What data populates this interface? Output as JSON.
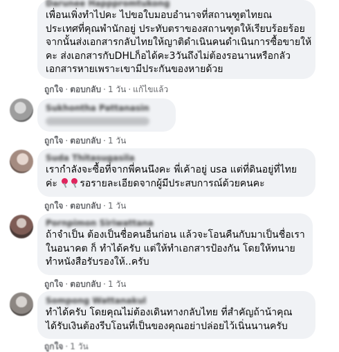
{
  "actions": {
    "like": "ถูกใจ",
    "reply": "ตอบกลับ",
    "edited": "แก้ไขแล้ว",
    "time": "1 วัน",
    "separator": "·"
  },
  "comments": [
    {
      "author": "Darunee Happpromtukong",
      "lines": [
        "เพื่อนเพิ่งทำไปคะ  ไปขอใบมอบอำนาจที่สถานฑูตไทยณ",
        "ประเทศที่คุณพำนักอยู่ ประทับตราของสถานฑูตให้เรียบร้อยร้อย",
        "จากนั้นส่งเอกสารกลับไทยให้ญาติดำเนินคนดำเนินการซื้อขายให้",
        "คะ ส่งเอกสารกับDHLก็อได้คะ3วันถึงไม่ต้องรอนานหรือกลัว",
        "เอกสารหายเพราะเขามีประกันของหายด้วย"
      ]
    },
    {
      "author": "Sukhontha Pattanasin",
      "lines": []
    },
    {
      "author": "Suda Thitasugasila",
      "lines": [
        "เรากำลังจะซื้อที่จากพี่คนนึงคะ  พี่เค้าอยู่ usa แต่ที่ดินอยู่ที่ไทย",
        "รอรายละเอียดจากผู้มีประสบการณ์ด้วยคนคะ"
      ],
      "line2_prefix": "ค่ะ"
    },
    {
      "author": "Pornpimon Siriwattana",
      "lines": [
        "ถ้าจำเป็น ต้องเป็นชื่อคนอื่นก่อน แล้วจะโอนคืนกับมาเป็นชื่อเรา",
        "ในอนาคต ก็ ทำได้ครับ  แต่ให้ทำเอกสารป้องกัน โดยให้ทนาย",
        "ทำหนังสือรับรองให้..ครับ"
      ]
    },
    {
      "author": "Sompong Wattanakul",
      "lines": [
        "ทำได้ครับ  โดยคุณไม่ต้องเดินทางกลับไทย  ที่สำคัญถ้าน้าคุณ",
        "ได้รับเงินต้องรีบโอนที่เป็นของคุณอย่าปล่อยไว้เนิ่นนานครับ"
      ]
    }
  ]
}
